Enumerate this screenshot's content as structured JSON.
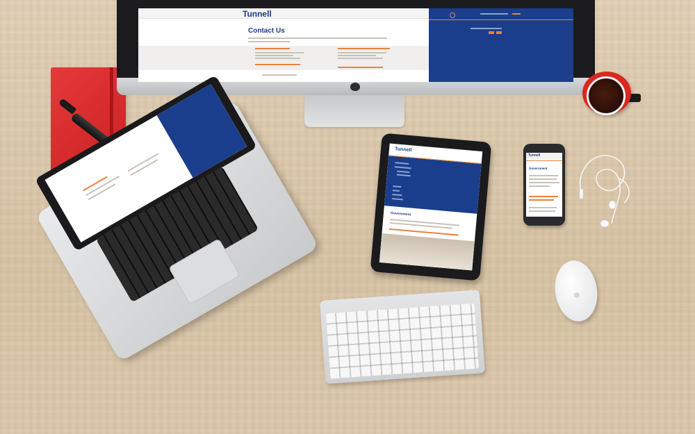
{
  "scene": {
    "description_tags": [
      "monitor",
      "laptop",
      "tablet",
      "phone",
      "keyboard",
      "mouse",
      "notebook",
      "marker",
      "coffee-cup",
      "earphones"
    ]
  },
  "monitor_site": {
    "logo": "Tunnell",
    "logo_tagline": "",
    "heading": "Contact Us",
    "phone_number": "",
    "office_left_label": "",
    "office_right_label": ""
  },
  "tablet_site": {
    "logo": "Tunnell",
    "heading": "Government"
  },
  "phone_site": {
    "logo": "Tunnell",
    "heading": "Government"
  },
  "colors": {
    "brand_blue": "#1a3e8c",
    "accent_orange": "#e8823a",
    "notebook_red": "#d42a2c",
    "desk": "#dcc9ae"
  }
}
